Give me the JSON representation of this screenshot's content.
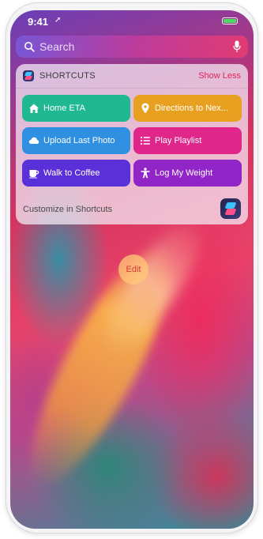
{
  "status_bar": {
    "time": "9:41",
    "location_glyph": "➚"
  },
  "search": {
    "placeholder": "Search"
  },
  "widget": {
    "title": "SHORTCUTS",
    "toggle_label": "Show Less",
    "shortcuts": [
      {
        "label": "Home ETA",
        "icon": "house-icon",
        "color": "#20b890"
      },
      {
        "label": "Directions to Nex...",
        "icon": "map-pin-icon",
        "color": "#e8a020"
      },
      {
        "label": "Upload Last Photo",
        "icon": "cloud-icon",
        "color": "#2f8fe0"
      },
      {
        "label": "Play Playlist",
        "icon": "list-icon",
        "color": "#e0268a"
      },
      {
        "label": "Walk to Coffee",
        "icon": "coffee-cup-icon",
        "color": "#5a31d8"
      },
      {
        "label": "Log My Weight",
        "icon": "person-icon",
        "color": "#9125c8"
      }
    ],
    "customize_label": "Customize in Shortcuts"
  },
  "edit_label": "Edit",
  "colors": {
    "accent": "#e0245e",
    "battery": "#4cd964"
  }
}
